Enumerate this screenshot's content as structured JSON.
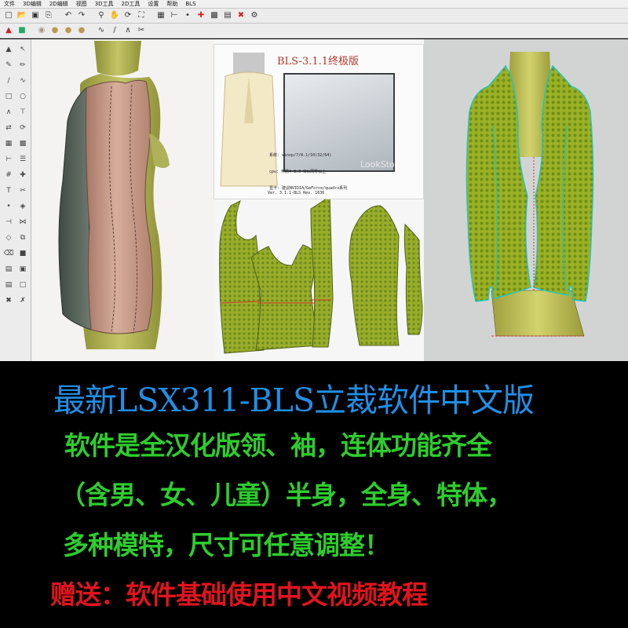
{
  "menu": {
    "items": [
      "文件",
      "3D编辑",
      "2D编辑",
      "视图",
      "3D工具",
      "2D工具",
      "设置",
      "帮助",
      "BLS"
    ]
  },
  "toolbar_icons": {
    "row1": [
      "new-icon",
      "open-icon",
      "save-icon",
      "print-icon",
      "undo-icon",
      "redo-icon",
      "zoom-icon",
      "pan-icon",
      "rotate-icon",
      "fit-icon",
      "grid-icon",
      "measure-icon",
      "point-icon",
      "cross-icon",
      "table-icon",
      "layers-icon",
      "clear-icon",
      "settings-icon"
    ],
    "row2": [
      "select-icon",
      "color-icon",
      "mannequin-icon",
      "bodice-icon",
      "sleeve-icon",
      "collar-icon",
      "curve-icon",
      "line-icon",
      "dart-icon",
      "scissors-icon"
    ]
  },
  "splash": {
    "title": "BLS-3.1.1终极版",
    "info_lines": [
      "系统: winxp/7/8.1/10(32/64)",
      "cpu: 奔腾4 3.0 GHz同等以上",
      "显卡: 建议NVIDIA/GeForce/quadro系列"
    ],
    "watermark": "LookSto",
    "version": "Ver. 3.1.1-BLS   Rev. 1636"
  },
  "colors": {
    "caption_title": "#1f8fe6",
    "caption_green": "#2ecc2e",
    "caption_red": "#e0141e",
    "fabric_green": "#9aad2a",
    "mannequin": "#b4b550",
    "bodice_pink": "#c79a8a",
    "bodice_side": "#5e6a60"
  },
  "caption": {
    "title": "最新LSX311-BLS立裁软件中文版",
    "line1": "软件是全汉化版领、袖，连体功能齐全",
    "line2": "（含男、女、儿童）半身，全身、特体，",
    "line3": "多种模特，尺寸可任意调整！",
    "line4": "赠送：软件基础使用中文视频教程"
  }
}
